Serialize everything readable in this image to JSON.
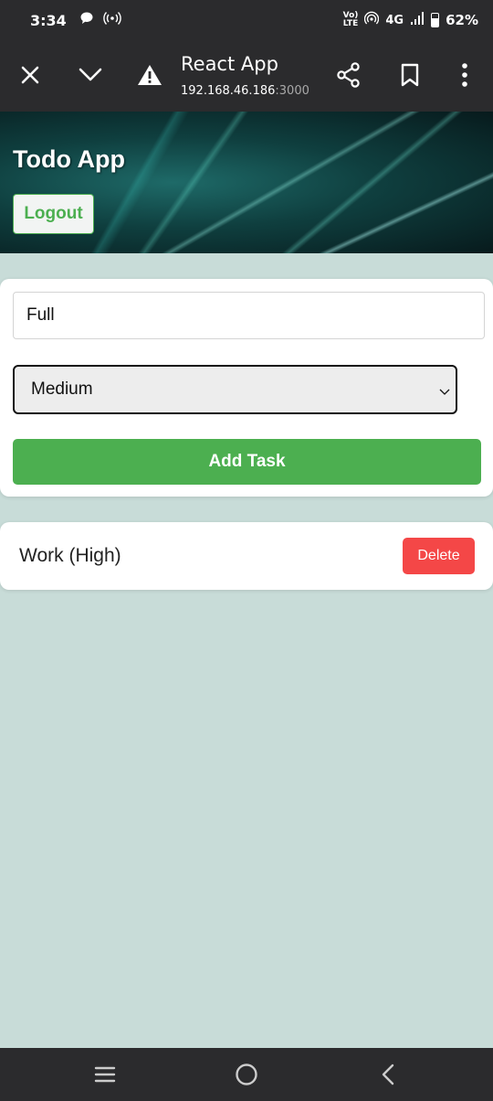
{
  "statusbar": {
    "time": "3:34",
    "network": "4G",
    "lte": "LTE",
    "battery": "62%",
    "icons": [
      "chat-icon",
      "hotspot-icon",
      "volte-icon",
      "wifi-calling-icon",
      "signal-icon",
      "battery-icon"
    ]
  },
  "browser": {
    "title": "React App",
    "url_host": "192.168.46.186",
    "url_port": ":3000",
    "icons": [
      "close-icon",
      "chevron-down-icon",
      "warning-icon",
      "share-icon",
      "bookmark-icon",
      "more-vert-icon"
    ]
  },
  "header": {
    "title": "Todo App",
    "logout_label": "Logout"
  },
  "form": {
    "task_value": "Full",
    "priority_selected": "Medium",
    "add_label": "Add Task"
  },
  "tasks": [
    {
      "text": "Work (High)",
      "delete_label": "Delete"
    }
  ],
  "navbar": {
    "icons": [
      "recent-apps-icon",
      "home-icon",
      "back-icon"
    ]
  },
  "colors": {
    "accent_green": "#4caf50",
    "delete_red": "#f44747",
    "page_bg": "#c8dcd8",
    "bar_dark": "#2b2b2d"
  }
}
